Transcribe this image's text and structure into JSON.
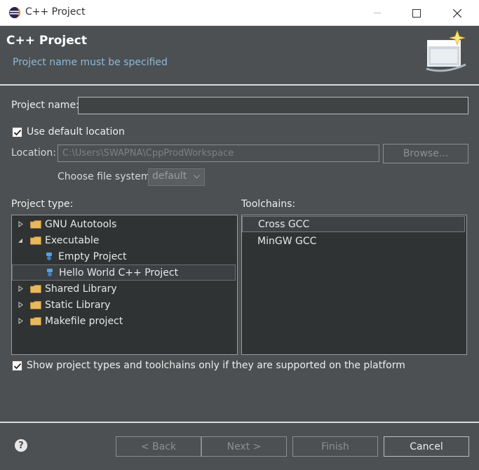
{
  "window": {
    "title": "C++ Project",
    "app_icon": "eclipse-icon"
  },
  "header": {
    "title": "C++ Project",
    "message": "Project name must be specified"
  },
  "form": {
    "project_name_label": "Project name:",
    "project_name_value": "",
    "use_default_location": {
      "label": "Use default location",
      "checked": true
    },
    "location_label": "Location:",
    "location_value": "C:\\Users\\SWAPNA\\CppProdWorkspace",
    "browse_label": "Browse...",
    "file_system_label": "Choose file system:",
    "file_system_value": "default"
  },
  "project_type": {
    "label": "Project type:",
    "items": [
      {
        "label": "GNU Autotools",
        "kind": "folder",
        "expanded": false,
        "level": 0
      },
      {
        "label": "Executable",
        "kind": "folder",
        "expanded": true,
        "level": 0
      },
      {
        "label": "Empty Project",
        "kind": "project",
        "level": 1
      },
      {
        "label": "Hello World C++ Project",
        "kind": "project",
        "level": 1,
        "selected": true
      },
      {
        "label": "Shared Library",
        "kind": "folder",
        "expanded": false,
        "level": 0
      },
      {
        "label": "Static Library",
        "kind": "folder",
        "expanded": false,
        "level": 0
      },
      {
        "label": "Makefile project",
        "kind": "folder",
        "expanded": false,
        "level": 0
      }
    ]
  },
  "toolchains": {
    "label": "Toolchains:",
    "items": [
      {
        "label": "Cross GCC",
        "selected": true
      },
      {
        "label": "MinGW GCC",
        "selected": false
      }
    ]
  },
  "show_supported": {
    "label": "Show project types and toolchains only if they are supported on the platform",
    "checked": true
  },
  "buttons": {
    "back": "< Back",
    "next": "Next >",
    "finish": "Finish",
    "cancel": "Cancel"
  },
  "colors": {
    "background": "#4c5052",
    "panel": "#2f3334",
    "message": "#8fb8d8",
    "folder": "#e8b860"
  }
}
